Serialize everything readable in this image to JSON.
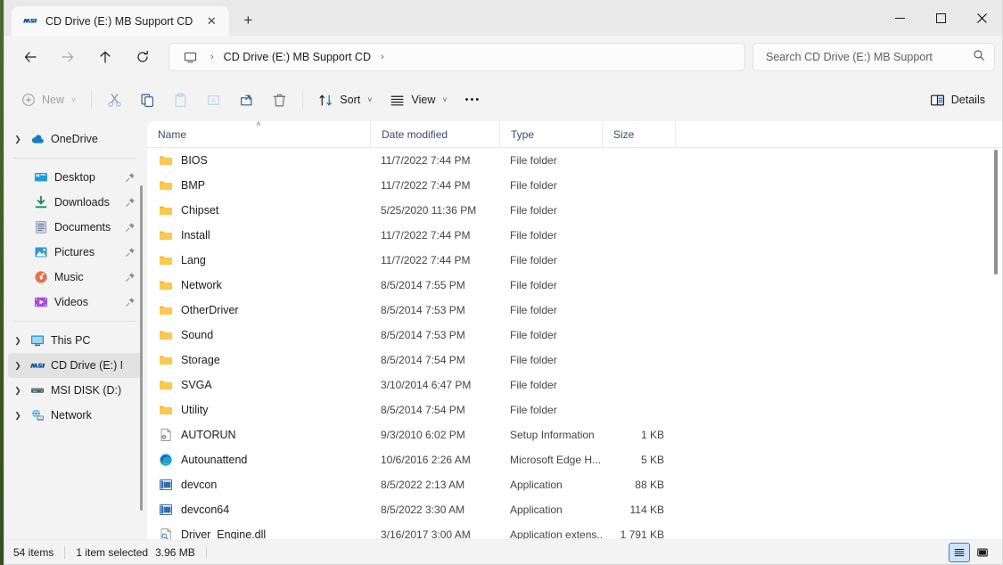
{
  "window": {
    "tab_title": "CD Drive (E:) MB Support CD",
    "tab_icon": "msi-logo-icon",
    "close_tab_label": "✕",
    "new_tab_label": "+",
    "minimize_label": "minimize-icon",
    "maximize_label": "maximize-icon",
    "close_label": "close-icon"
  },
  "nav": {
    "back_label": "←",
    "forward_label": "→",
    "up_label": "↑",
    "refresh_label": "⟳",
    "breadcrumb": {
      "root_icon": "this-pc-icon",
      "sep1": "›",
      "path": "CD Drive (E:) MB Support CD",
      "sep2": "›"
    },
    "search": {
      "placeholder": "Search CD Drive (E:) MB Support",
      "value": "",
      "icon": "search-icon"
    }
  },
  "toolbar": {
    "new_label": "New",
    "cut_label": "cut-icon",
    "copy_label": "copy-icon",
    "paste_label": "paste-icon",
    "rename_label": "rename-icon",
    "share_label": "share-icon",
    "delete_label": "delete-icon",
    "sort_label": "Sort",
    "view_label": "View",
    "more_label": "•••",
    "details_label": "Details",
    "chevron": "˅"
  },
  "sidebar": {
    "groups": [
      {
        "items": [
          {
            "label": "OneDrive",
            "icon": "onedrive-cloud-icon",
            "expandable": true,
            "pinned": false,
            "selected": false,
            "indent": 0
          }
        ]
      },
      {
        "items": [
          {
            "label": "Desktop",
            "icon": "desktop-icon",
            "expandable": false,
            "pinned": true,
            "selected": false,
            "indent": 1
          },
          {
            "label": "Downloads",
            "icon": "downloads-icon",
            "expandable": false,
            "pinned": true,
            "selected": false,
            "indent": 1
          },
          {
            "label": "Documents",
            "icon": "documents-icon",
            "expandable": false,
            "pinned": true,
            "selected": false,
            "indent": 1
          },
          {
            "label": "Pictures",
            "icon": "pictures-icon",
            "expandable": false,
            "pinned": true,
            "selected": false,
            "indent": 1
          },
          {
            "label": "Music",
            "icon": "music-icon",
            "expandable": false,
            "pinned": true,
            "selected": false,
            "indent": 1
          },
          {
            "label": "Videos",
            "icon": "videos-icon",
            "expandable": false,
            "pinned": true,
            "selected": false,
            "indent": 1
          }
        ]
      },
      {
        "items": [
          {
            "label": "This PC",
            "icon": "this-pc-icon",
            "expandable": true,
            "pinned": false,
            "selected": false,
            "indent": 0
          },
          {
            "label": "CD Drive (E:) MB",
            "icon": "msi-logo-icon",
            "expandable": true,
            "pinned": false,
            "selected": true,
            "indent": 0
          },
          {
            "label": "MSI DISK (D:)",
            "icon": "drive-icon",
            "expandable": true,
            "pinned": false,
            "selected": false,
            "indent": 0
          },
          {
            "label": "Network",
            "icon": "network-icon",
            "expandable": true,
            "pinned": false,
            "selected": false,
            "indent": 0
          }
        ]
      }
    ]
  },
  "filelist": {
    "columns": [
      {
        "label": "Name",
        "sorted": "asc",
        "sort_caret": "˄"
      },
      {
        "label": "Date modified",
        "sorted": ""
      },
      {
        "label": "Type",
        "sorted": ""
      },
      {
        "label": "Size",
        "sorted": ""
      }
    ],
    "rows": [
      {
        "name": "BIOS",
        "date": "11/7/2022 7:44 PM",
        "type": "File folder",
        "size": "",
        "icon": "folder-icon"
      },
      {
        "name": "BMP",
        "date": "11/7/2022 7:44 PM",
        "type": "File folder",
        "size": "",
        "icon": "folder-icon"
      },
      {
        "name": "Chipset",
        "date": "5/25/2020 11:36 PM",
        "type": "File folder",
        "size": "",
        "icon": "folder-icon"
      },
      {
        "name": "Install",
        "date": "11/7/2022 7:44 PM",
        "type": "File folder",
        "size": "",
        "icon": "folder-icon"
      },
      {
        "name": "Lang",
        "date": "11/7/2022 7:44 PM",
        "type": "File folder",
        "size": "",
        "icon": "folder-icon"
      },
      {
        "name": "Network",
        "date": "8/5/2014 7:55 PM",
        "type": "File folder",
        "size": "",
        "icon": "folder-icon"
      },
      {
        "name": "OtherDriver",
        "date": "8/5/2014 7:53 PM",
        "type": "File folder",
        "size": "",
        "icon": "folder-icon"
      },
      {
        "name": "Sound",
        "date": "8/5/2014 7:53 PM",
        "type": "File folder",
        "size": "",
        "icon": "folder-icon"
      },
      {
        "name": "Storage",
        "date": "8/5/2014 7:54 PM",
        "type": "File folder",
        "size": "",
        "icon": "folder-icon"
      },
      {
        "name": "SVGA",
        "date": "3/10/2014 6:47 PM",
        "type": "File folder",
        "size": "",
        "icon": "folder-icon"
      },
      {
        "name": "Utility",
        "date": "8/5/2014 7:54 PM",
        "type": "File folder",
        "size": "",
        "icon": "folder-icon"
      },
      {
        "name": "AUTORUN",
        "date": "9/3/2010 6:02 PM",
        "type": "Setup Information",
        "size": "1 KB",
        "icon": "setup-info-icon"
      },
      {
        "name": "Autounattend",
        "date": "10/6/2016 2:26 AM",
        "type": "Microsoft Edge H...",
        "size": "5 KB",
        "icon": "edge-icon"
      },
      {
        "name": "devcon",
        "date": "8/5/2022 2:13 AM",
        "type": "Application",
        "size": "88 KB",
        "icon": "application-icon"
      },
      {
        "name": "devcon64",
        "date": "8/5/2022 3:30 AM",
        "type": "Application",
        "size": "114 KB",
        "icon": "application-icon"
      },
      {
        "name": "Driver_Engine.dll",
        "date": "3/16/2017 3:00 AM",
        "type": "Application extens...",
        "size": "1 791 KB",
        "icon": "dll-icon"
      }
    ]
  },
  "statusbar": {
    "item_count": "54 items",
    "selection": "1 item selected",
    "selection_size": "3.96 MB",
    "details_view_label": "details-view-icon",
    "large_icons_view_label": "large-icons-view-icon"
  },
  "colors": {
    "accent": "#0078d4",
    "folder": "#f7c64c",
    "msi_blue": "#12549c",
    "header_text": "#3a4a6b",
    "selected_row": "#e2e2e2"
  }
}
